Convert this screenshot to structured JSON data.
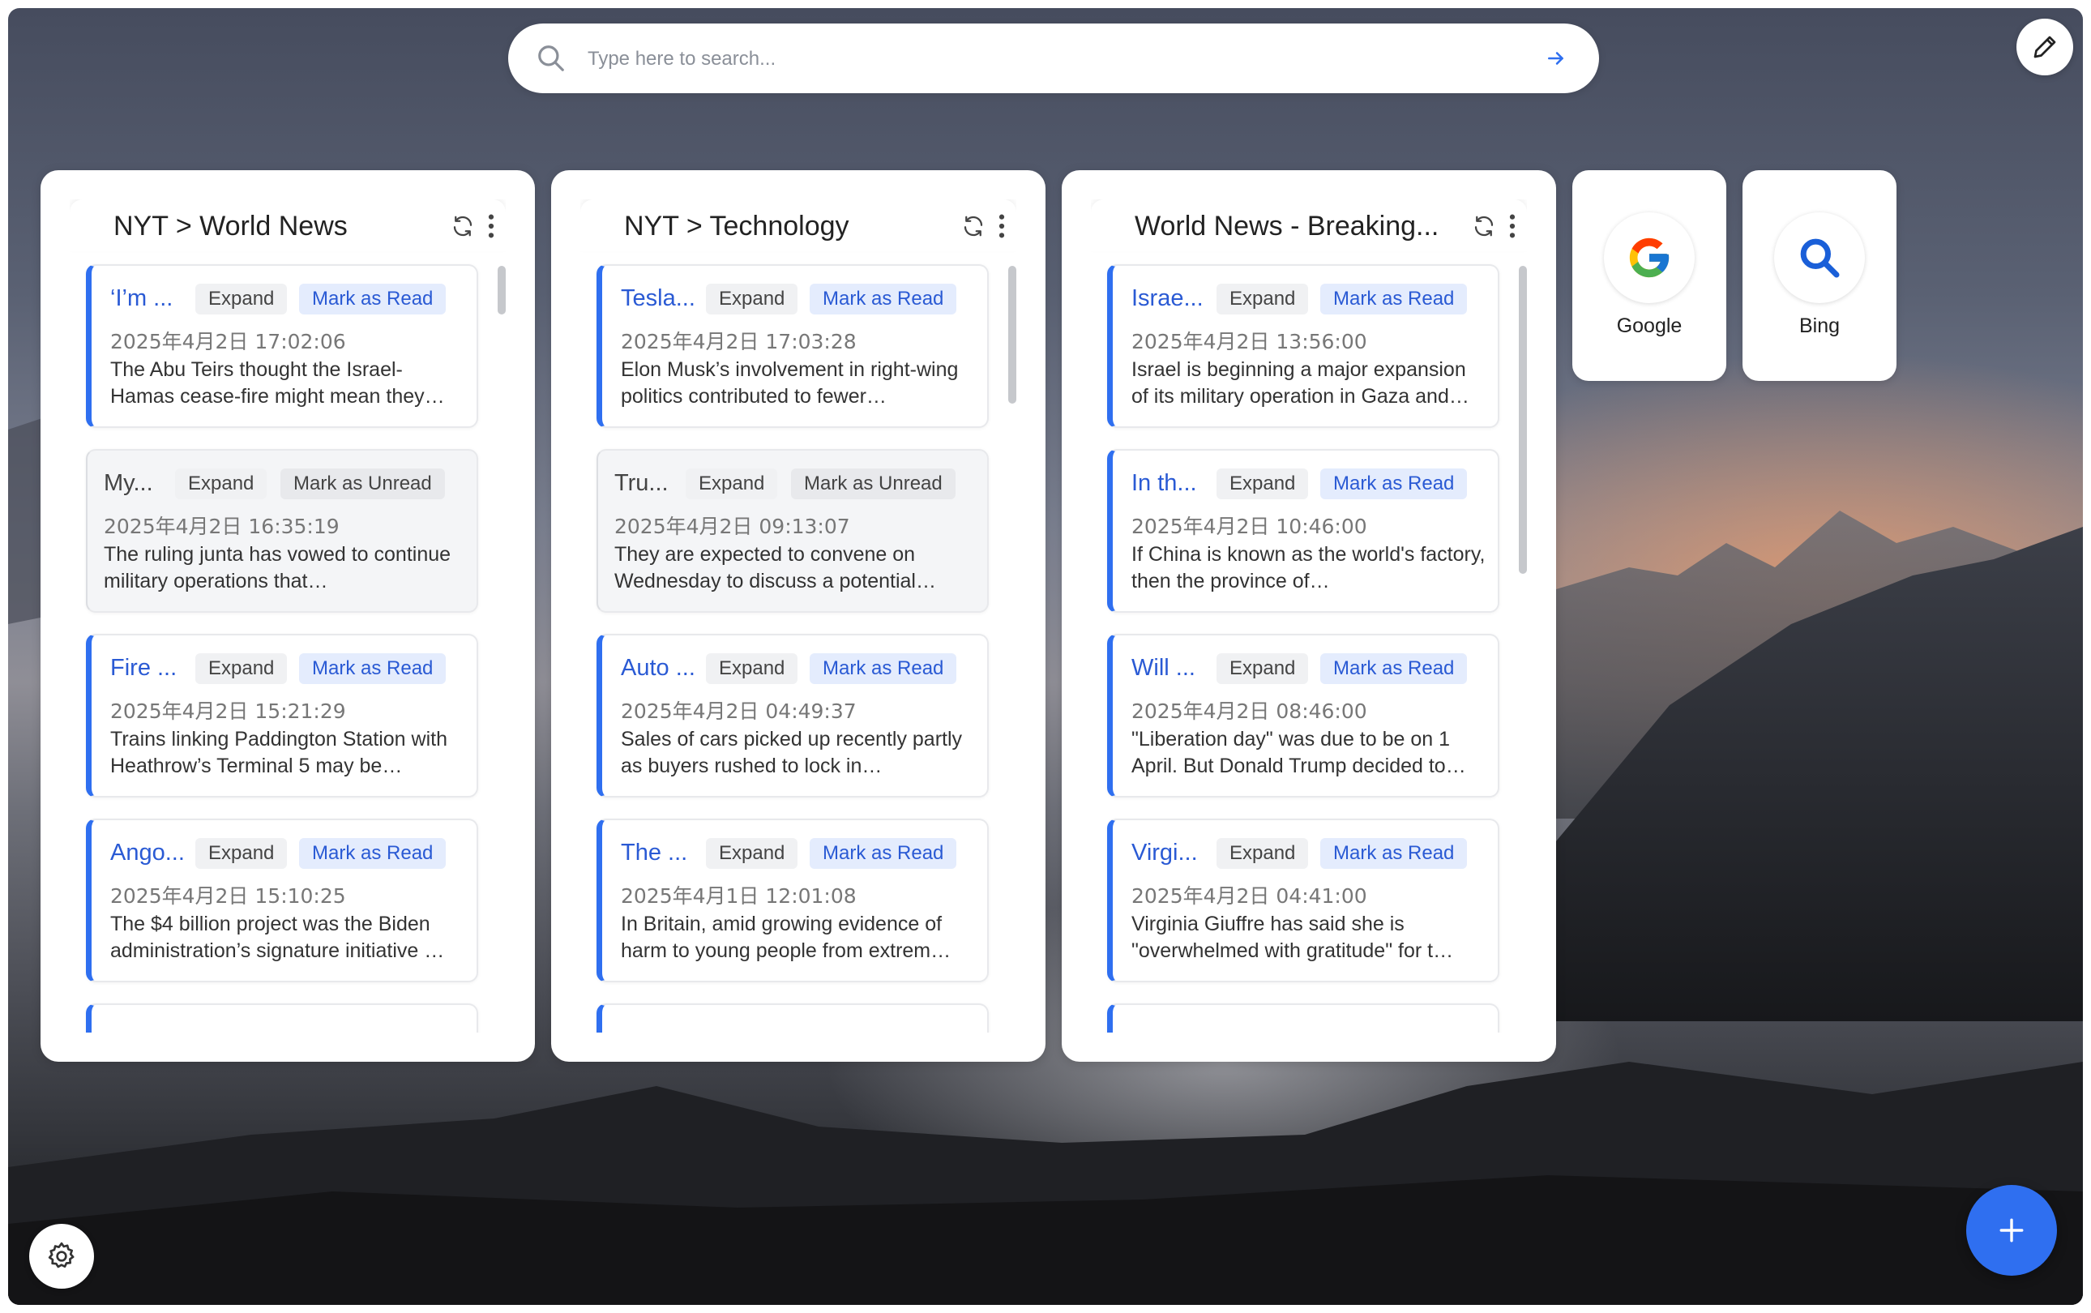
{
  "search": {
    "placeholder": "Type here to search..."
  },
  "feeds": [
    {
      "title": "NYT > World News",
      "items": [
        {
          "title": "‘I’m ...",
          "expand": "Expand",
          "mark": "Mark as Read",
          "date": "2025年4月2日 17:02:06",
          "desc": "The Abu Teirs thought the Israel-Hamas cease-fire might mean they…",
          "read": false
        },
        {
          "title": "My...",
          "expand": "Expand",
          "mark": "Mark as Unread",
          "date": "2025年4月2日 16:35:19",
          "desc": "The ruling junta has vowed to continue military operations that…",
          "read": true
        },
        {
          "title": "Fire ...",
          "expand": "Expand",
          "mark": "Mark as Read",
          "date": "2025年4月2日 15:21:29",
          "desc": "Trains linking Paddington Station with Heathrow’s Terminal 5 may be…",
          "read": false
        },
        {
          "title": "Ango...",
          "expand": "Expand",
          "mark": "Mark as Read",
          "date": "2025年4月2日 15:10:25",
          "desc": "The $4 billion project was the Biden administration’s signature initiative …",
          "read": false
        }
      ]
    },
    {
      "title": "NYT > Technology",
      "items": [
        {
          "title": "Tesla...",
          "expand": "Expand",
          "mark": "Mark as Read",
          "date": "2025年4月2日 17:03:28",
          "desc": "Elon Musk’s involvement in right-wing politics contributed to fewer…",
          "read": false
        },
        {
          "title": "Tru...",
          "expand": "Expand",
          "mark": "Mark as Unread",
          "date": "2025年4月2日 09:13:07",
          "desc": "They are expected to convene on Wednesday to discuss a potential…",
          "read": true
        },
        {
          "title": "Auto ...",
          "expand": "Expand",
          "mark": "Mark as Read",
          "date": "2025年4月2日 04:49:37",
          "desc": "Sales of cars picked up recently partly as buyers rushed to lock in…",
          "read": false
        },
        {
          "title": "The ...",
          "expand": "Expand",
          "mark": "Mark as Read",
          "date": "2025年4月1日 12:01:08",
          "desc": "In Britain, amid growing evidence of harm to young people from extrem…",
          "read": false
        }
      ]
    },
    {
      "title": "World News - Breaking...",
      "items": [
        {
          "title": "Israe...",
          "expand": "Expand",
          "mark": "Mark as Read",
          "date": "2025年4月2日 13:56:00",
          "desc": "Israel is beginning a major expansion of its military operation in Gaza and…",
          "read": false
        },
        {
          "title": "In th...",
          "expand": "Expand",
          "mark": "Mark as Read",
          "date": "2025年4月2日 10:46:00",
          "desc": "If China is known as the world's factory, then the province of…",
          "read": false
        },
        {
          "title": "Will ...",
          "expand": "Expand",
          "mark": "Mark as Read",
          "date": "2025年4月2日 08:46:00",
          "desc": "\"Liberation day\" was due to be on 1 April. But Donald Trump decided to…",
          "read": false
        },
        {
          "title": "Virgi...",
          "expand": "Expand",
          "mark": "Mark as Read",
          "date": "2025年4月2日 04:41:00",
          "desc": "Virginia Giuffre has said she is \"overwhelmed with gratitude\" for t…",
          "read": false
        }
      ]
    }
  ],
  "shortcuts": [
    {
      "label": "Google",
      "icon": "google-icon"
    },
    {
      "label": "Bing",
      "icon": "bing-search-icon"
    }
  ],
  "colors": {
    "accent": "#2f6ff0",
    "link": "#2a5ad4"
  }
}
